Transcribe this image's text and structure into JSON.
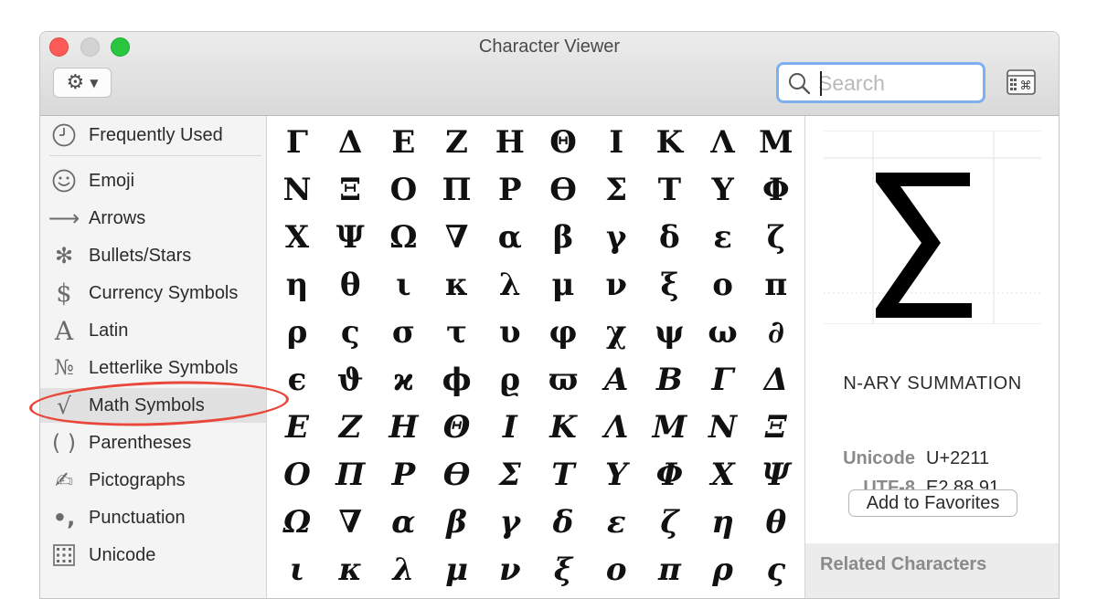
{
  "window": {
    "title": "Character Viewer"
  },
  "toolbar": {
    "gear_icon": "gear-icon",
    "search_placeholder": "Search",
    "search_value": ""
  },
  "sidebar": {
    "items": [
      {
        "label": "Frequently Used",
        "icon": "clock-icon"
      },
      {
        "label": "Emoji",
        "icon": "smiley-icon"
      },
      {
        "label": "Arrows",
        "icon": "arrow-icon"
      },
      {
        "label": "Bullets/Stars",
        "icon": "asterisk-icon"
      },
      {
        "label": "Currency Symbols",
        "icon": "dollar-icon"
      },
      {
        "label": "Latin",
        "icon": "latin-a-icon"
      },
      {
        "label": "Letterlike Symbols",
        "icon": "numero-icon"
      },
      {
        "label": "Math Symbols",
        "icon": "square-root-icon",
        "selected": true
      },
      {
        "label": "Parentheses",
        "icon": "parentheses-icon"
      },
      {
        "label": "Pictographs",
        "icon": "pictograph-icon"
      },
      {
        "label": "Punctuation",
        "icon": "punctuation-icon"
      },
      {
        "label": "Unicode",
        "icon": "grid-icon"
      }
    ],
    "highlight_color": "#e8473a"
  },
  "grid": {
    "rows": [
      {
        "italic": false,
        "chars": [
          "Γ",
          "Δ",
          "Ε",
          "Ζ",
          "Η",
          "Θ",
          "Ι",
          "Κ",
          "Λ",
          "Μ"
        ]
      },
      {
        "italic": false,
        "chars": [
          "Ν",
          "Ξ",
          "Ο",
          "Π",
          "Ρ",
          "ϴ",
          "Σ",
          "Τ",
          "Υ",
          "Φ"
        ]
      },
      {
        "italic": false,
        "chars": [
          "Χ",
          "Ψ",
          "Ω",
          "∇",
          "α",
          "β",
          "γ",
          "δ",
          "ε",
          "ζ"
        ]
      },
      {
        "italic": false,
        "chars": [
          "η",
          "θ",
          "ι",
          "κ",
          "λ",
          "μ",
          "ν",
          "ξ",
          "ο",
          "π"
        ]
      },
      {
        "italic": false,
        "chars": [
          "ρ",
          "ς",
          "σ",
          "τ",
          "υ",
          "φ",
          "χ",
          "ψ",
          "ω",
          "∂"
        ]
      },
      {
        "italic": false,
        "chars": [
          "ϵ",
          "ϑ",
          "ϰ",
          "ϕ",
          "ϱ",
          "ϖ",
          "Α",
          "Β",
          "Γ",
          "Δ"
        ],
        "italic_from": 6
      },
      {
        "italic": true,
        "chars": [
          "Ε",
          "Ζ",
          "Η",
          "Θ",
          "Ι",
          "Κ",
          "Λ",
          "Μ",
          "Ν",
          "Ξ"
        ]
      },
      {
        "italic": true,
        "chars": [
          "Ο",
          "Π",
          "Ρ",
          "ϴ",
          "Σ",
          "Τ",
          "Υ",
          "Φ",
          "Χ",
          "Ψ"
        ]
      },
      {
        "italic": true,
        "chars": [
          "Ω",
          "∇",
          "α",
          "β",
          "γ",
          "δ",
          "ε",
          "ζ",
          "η",
          "θ"
        ]
      },
      {
        "italic": true,
        "chars": [
          "ι",
          "κ",
          "λ",
          "μ",
          "ν",
          "ξ",
          "ο",
          "π",
          "ρ",
          "ς"
        ]
      }
    ]
  },
  "detail": {
    "glyph": "∑",
    "name": "N-ARY SUMMATION",
    "unicode_label": "Unicode",
    "unicode_value": "U+2211",
    "utf8_label": "UTF-8",
    "utf8_value": "E2 88 91",
    "favorites_button": "Add to Favorites",
    "related_heading": "Related Characters"
  }
}
